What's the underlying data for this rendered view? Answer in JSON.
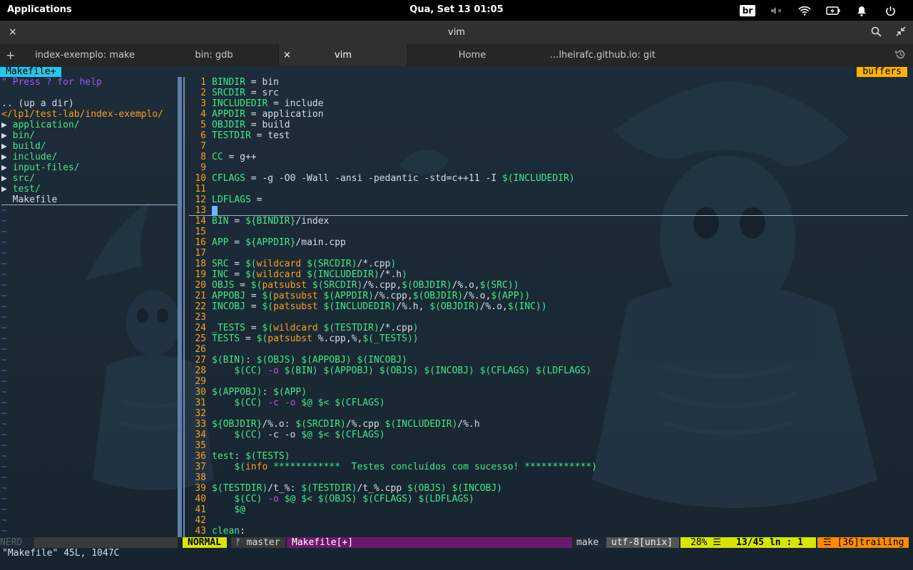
{
  "topbar": {
    "apps": "Applications",
    "clock": "Qua, Set 13   01:05",
    "keyboard": "br"
  },
  "window": {
    "title": "vim",
    "close": "×"
  },
  "tabs": [
    {
      "label": "index-exemplo: make"
    },
    {
      "label": "bin: gdb"
    },
    {
      "label": "vim",
      "close": "×"
    },
    {
      "label": "Home"
    },
    {
      "label": "...lheirafc.github.io: git"
    }
  ],
  "vim": {
    "tab_left": "Makefile+",
    "tab_right": "buffers",
    "nerd": {
      "help": "\" Press ? for help",
      "updir": ".. (up a dir)",
      "path": "</lp1/test-lab/index-exemplo/",
      "dirs": [
        "application/",
        "bin/",
        "build/",
        "include/",
        "input-files/",
        "src/",
        "test/"
      ],
      "file": "Makefile",
      "dir_marker": "▶",
      "tilde": "~",
      "label": "NERD"
    },
    "code": [
      {
        "n": "1",
        "s": [
          [
            "kw",
            "BINDIR"
          ],
          [
            "p",
            " = bin"
          ]
        ]
      },
      {
        "n": "2",
        "s": [
          [
            "kw",
            "SRCDIR"
          ],
          [
            "p",
            " = src"
          ]
        ]
      },
      {
        "n": "3",
        "s": [
          [
            "kw",
            "INCLUDEDIR"
          ],
          [
            "p",
            " = include"
          ]
        ]
      },
      {
        "n": "4",
        "s": [
          [
            "kw",
            "APPDIR"
          ],
          [
            "p",
            " = application"
          ]
        ]
      },
      {
        "n": "5",
        "s": [
          [
            "kw",
            "OBJDIR"
          ],
          [
            "p",
            " = build"
          ]
        ]
      },
      {
        "n": "6",
        "s": [
          [
            "kw",
            "TESTDIR"
          ],
          [
            "p",
            " = test"
          ]
        ]
      },
      {
        "n": "7",
        "s": []
      },
      {
        "n": "8",
        "s": [
          [
            "kw",
            "CC"
          ],
          [
            "p",
            " = g++"
          ]
        ]
      },
      {
        "n": "9",
        "s": []
      },
      {
        "n": "10",
        "s": [
          [
            "kw",
            "CFLAGS"
          ],
          [
            "p",
            " = -g -O0 -Wall -ansi -pedantic -std=c++11 -I "
          ],
          [
            "kw",
            "$(INCLUDEDIR)"
          ]
        ]
      },
      {
        "n": "11",
        "s": []
      },
      {
        "n": "12",
        "s": [
          [
            "kw",
            "LDFLAGS"
          ],
          [
            "p",
            " ="
          ]
        ]
      },
      {
        "n": "13",
        "s": []
      },
      {
        "n": "14",
        "s": [
          [
            "kw",
            "BIN"
          ],
          [
            "p",
            " = "
          ],
          [
            "kw",
            "${BINDIR}"
          ],
          [
            "p",
            "/index"
          ]
        ]
      },
      {
        "n": "15",
        "s": []
      },
      {
        "n": "16",
        "s": [
          [
            "kw",
            "APP"
          ],
          [
            "p",
            " = "
          ],
          [
            "kw",
            "${APPDIR}"
          ],
          [
            "p",
            "/main.cpp"
          ]
        ]
      },
      {
        "n": "17",
        "s": []
      },
      {
        "n": "18",
        "s": [
          [
            "kw",
            "SRC"
          ],
          [
            "p",
            " = "
          ],
          [
            "kw",
            "$("
          ],
          [
            "fn",
            "wildcard"
          ],
          [
            "kw",
            " $(SRCDIR)"
          ],
          [
            "p",
            "/*.cpp"
          ],
          [
            "kw",
            ")"
          ]
        ]
      },
      {
        "n": "19",
        "s": [
          [
            "kw",
            "INC"
          ],
          [
            "p",
            " = "
          ],
          [
            "kw",
            "$("
          ],
          [
            "fn",
            "wildcard"
          ],
          [
            "kw",
            " $(INCLUDEDIR)"
          ],
          [
            "p",
            "/*.h"
          ],
          [
            "kw",
            ")"
          ]
        ]
      },
      {
        "n": "20",
        "s": [
          [
            "kw",
            "OBJS"
          ],
          [
            "p",
            " = "
          ],
          [
            "kw",
            "$("
          ],
          [
            "fn",
            "patsubst"
          ],
          [
            "kw",
            " $(SRCDIR)"
          ],
          [
            "p",
            "/%.cpp,"
          ],
          [
            "kw",
            "$(OBJDIR)"
          ],
          [
            "p",
            "/%.o,"
          ],
          [
            "kw",
            "$(SRC))"
          ]
        ]
      },
      {
        "n": "21",
        "s": [
          [
            "kw",
            "APPOBJ"
          ],
          [
            "p",
            " = "
          ],
          [
            "kw",
            "$("
          ],
          [
            "fn",
            "patsubst"
          ],
          [
            "kw",
            " $(APPDIR)"
          ],
          [
            "p",
            "/%.cpp,"
          ],
          [
            "kw",
            "$(OBJDIR)"
          ],
          [
            "p",
            "/%.o,"
          ],
          [
            "kw",
            "$(APP))"
          ]
        ]
      },
      {
        "n": "22",
        "s": [
          [
            "kw",
            "INCOBJ"
          ],
          [
            "p",
            " = "
          ],
          [
            "kw",
            "$("
          ],
          [
            "fn",
            "patsubst"
          ],
          [
            "kw",
            " $(INCLUDEDIR)"
          ],
          [
            "p",
            "/%.h, "
          ],
          [
            "kw",
            "$(OBJDIR)"
          ],
          [
            "p",
            "/%.o,"
          ],
          [
            "kw",
            "$(INC))"
          ]
        ]
      },
      {
        "n": "23",
        "s": []
      },
      {
        "n": "24",
        "s": [
          [
            "kw",
            "_TESTS"
          ],
          [
            "p",
            " = "
          ],
          [
            "kw",
            "$("
          ],
          [
            "fn",
            "wildcard"
          ],
          [
            "kw",
            " $(TESTDIR)"
          ],
          [
            "p",
            "/*.cpp"
          ],
          [
            "kw",
            ")"
          ]
        ]
      },
      {
        "n": "25",
        "s": [
          [
            "kw",
            "TESTS"
          ],
          [
            "p",
            " = "
          ],
          [
            "kw",
            "$("
          ],
          [
            "fn",
            "patsubst"
          ],
          [
            "p",
            " %.cpp,%,"
          ],
          [
            "kw",
            "$(_TESTS))"
          ]
        ]
      },
      {
        "n": "26",
        "s": []
      },
      {
        "n": "27",
        "s": [
          [
            "kw",
            "$(BIN)"
          ],
          [
            "p",
            ": "
          ],
          [
            "kw",
            "$(OBJS) $(APPOBJ) $(INCOBJ)"
          ]
        ]
      },
      {
        "n": "28",
        "s": [
          [
            "p",
            "    "
          ],
          [
            "kw",
            "$(CC)"
          ],
          [
            "m",
            " -o "
          ],
          [
            "kw",
            "$(BIN) $(APPOBJ) $(OBJS) $(INCOBJ) $(CFLAGS) $(LDFLAGS)"
          ]
        ]
      },
      {
        "n": "29",
        "s": []
      },
      {
        "n": "30",
        "s": [
          [
            "kw",
            "$(APPOBJ)"
          ],
          [
            "p",
            ": "
          ],
          [
            "kw",
            "$(APP)"
          ]
        ]
      },
      {
        "n": "31",
        "s": [
          [
            "p",
            "    "
          ],
          [
            "kw",
            "$(CC)"
          ],
          [
            "m",
            " -c -o "
          ],
          [
            "kw",
            "$@ $< $(CFLAGS)"
          ]
        ]
      },
      {
        "n": "32",
        "s": []
      },
      {
        "n": "33",
        "s": [
          [
            "kw",
            "${OBJDIR}"
          ],
          [
            "p",
            "/%.o: "
          ],
          [
            "kw",
            "$(SRCDIR)"
          ],
          [
            "p",
            "/%.cpp "
          ],
          [
            "kw",
            "$(INCLUDEDIR)"
          ],
          [
            "p",
            "/%.h"
          ]
        ]
      },
      {
        "n": "34",
        "s": [
          [
            "p",
            "    "
          ],
          [
            "kw",
            "$(CC)"
          ],
          [
            "p",
            " -c -o "
          ],
          [
            "kw",
            "$@ $< $(CFLAGS)"
          ]
        ]
      },
      {
        "n": "35",
        "s": []
      },
      {
        "n": "36",
        "s": [
          [
            "kw",
            "test"
          ],
          [
            "p",
            ": "
          ],
          [
            "kw",
            "$(TESTS)"
          ]
        ]
      },
      {
        "n": "37",
        "s": [
          [
            "p",
            "    "
          ],
          [
            "kw",
            "$("
          ],
          [
            "fn",
            "info"
          ],
          [
            "kw",
            " ************  Testes concluídos com sucesso! ************)"
          ]
        ]
      },
      {
        "n": "38",
        "s": []
      },
      {
        "n": "39",
        "s": [
          [
            "kw",
            "$(TESTDIR)"
          ],
          [
            "p",
            "/t_%: "
          ],
          [
            "kw",
            "$(TESTDIR)"
          ],
          [
            "p",
            "/t_%.cpp "
          ],
          [
            "kw",
            "$(OBJS) $(INCOBJ)"
          ]
        ]
      },
      {
        "n": "40",
        "s": [
          [
            "p",
            "    "
          ],
          [
            "kw",
            "$(CC)"
          ],
          [
            "m",
            " -o "
          ],
          [
            "kw",
            "$@ $< $(OBJS) $(CFLAGS) $(LDFLAGS)"
          ]
        ]
      },
      {
        "n": "41",
        "s": [
          [
            "p",
            "    "
          ],
          [
            "kw",
            "$@"
          ]
        ]
      },
      {
        "n": "42",
        "s": []
      },
      {
        "n": "43",
        "s": [
          [
            "kw",
            "clean"
          ],
          [
            "p",
            ":"
          ]
        ]
      }
    ],
    "statusline": {
      "mode": "NORMAL",
      "branch": "ᚠ master",
      "file": "Makefile[+]",
      "filetype": "make",
      "encoding": "utf-8[unix]",
      "percent": "28% ☰",
      "position": "13/45 ln  :  1",
      "trailing": "☲ [36]trailing"
    },
    "cmdline": "\"Makefile\" 45L, 1047C"
  },
  "colors": {
    "keyword": "#43e888",
    "function": "#ff9f1c",
    "option": "#d54ad6",
    "linenr": "#ff9f1c",
    "tilde": "#3d6db0",
    "mode": "#d7e600",
    "file_bg": "#6b1a6b"
  }
}
